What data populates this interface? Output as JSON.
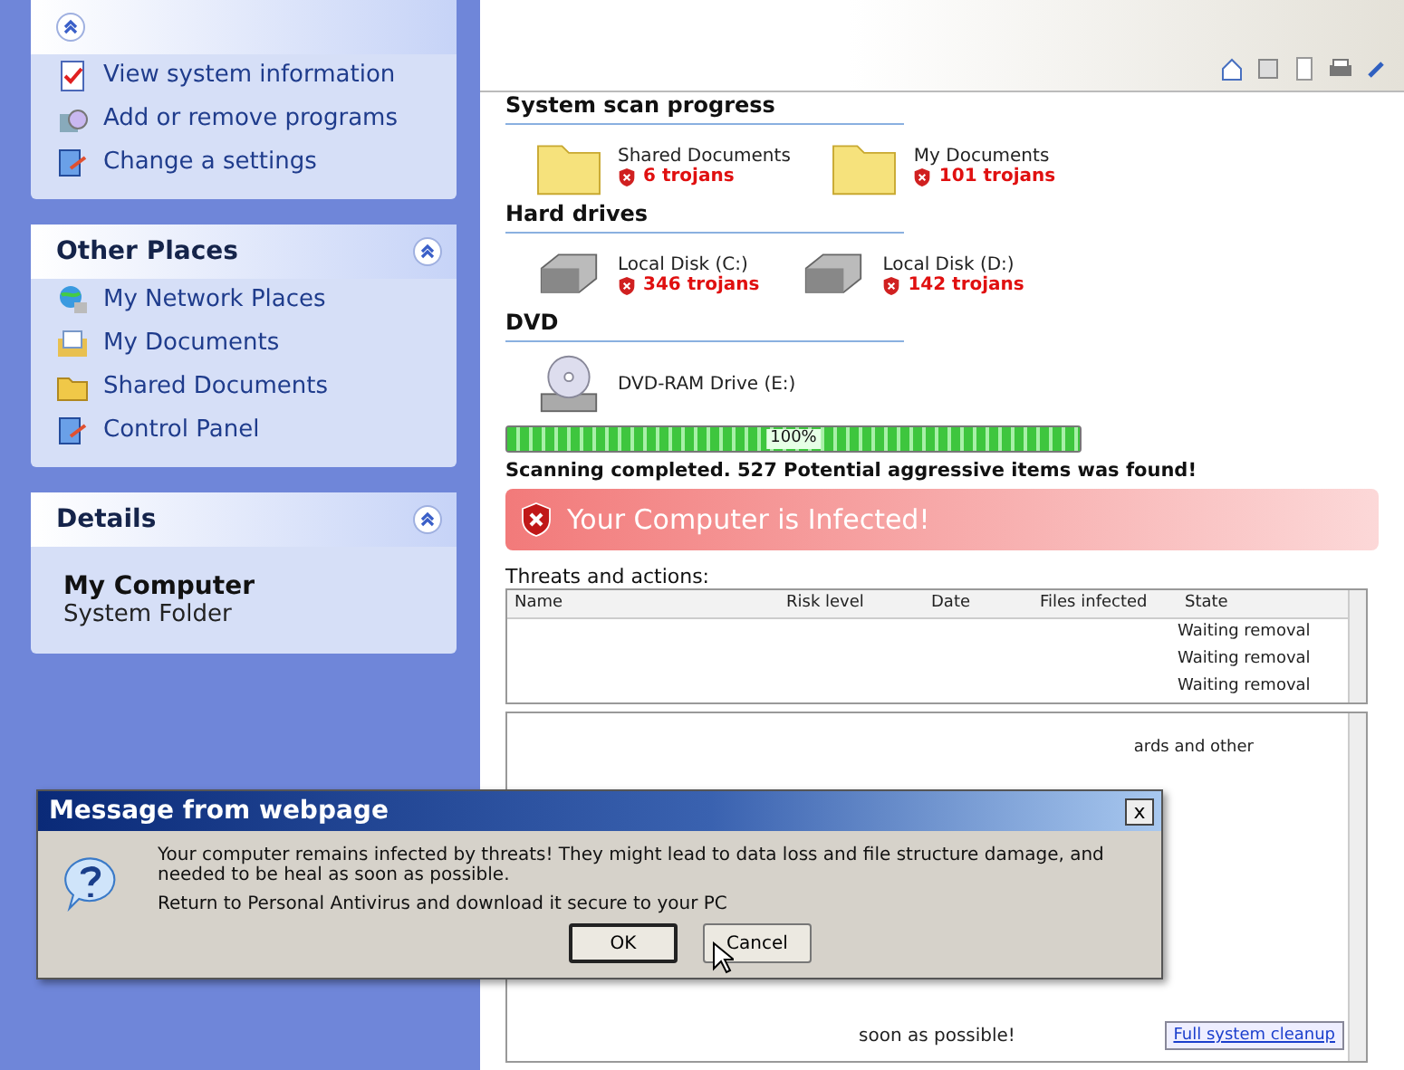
{
  "sidebar": {
    "panels": [
      {
        "items": [
          {
            "label": "View system information",
            "kind": "info"
          },
          {
            "label": "Add or remove programs",
            "kind": "programs"
          },
          {
            "label": "Change a settings",
            "kind": "settings"
          }
        ]
      },
      {
        "title": "Other Places",
        "items": [
          {
            "label": "My Network Places",
            "kind": "network"
          },
          {
            "label": "My Documents",
            "kind": "documents"
          },
          {
            "label": "Shared Documents",
            "kind": "folder"
          },
          {
            "label": "Control Panel",
            "kind": "settings"
          }
        ]
      }
    ],
    "details": {
      "title": "Details",
      "name": "My Computer",
      "subtitle": "System Folder"
    }
  },
  "scan": {
    "sections": [
      {
        "title": "System scan progress",
        "items": [
          {
            "label": "Shared Documents",
            "kind": "folder",
            "threats": "6 trojans"
          },
          {
            "label": "My Documents",
            "kind": "folder",
            "threats": "101 trojans"
          }
        ]
      },
      {
        "title": "Hard drives",
        "items": [
          {
            "label": "Local Disk (C:)",
            "kind": "disk",
            "threats": "346 trojans"
          },
          {
            "label": "Local Disk (D:)",
            "kind": "disk",
            "threats": "142 trojans"
          }
        ]
      },
      {
        "title": "DVD",
        "items": [
          {
            "label": "DVD-RAM Drive (E:)",
            "kind": "dvd"
          }
        ]
      }
    ],
    "progress": {
      "level": 1,
      "label": "100%"
    },
    "message": "Scanning completed. 527 Potential aggressive items was found!",
    "alert": "Your Computer is Infected!"
  },
  "threats": {
    "label": "Threats and actions:",
    "columns": [
      "Name",
      "Risk level",
      "Date",
      "Files infected",
      "State"
    ],
    "rows": [
      {
        "state": "Waiting removal"
      },
      {
        "state": "Waiting removal"
      },
      {
        "state": "Waiting removal"
      }
    ]
  },
  "lower_panel": {
    "text_1": "ards and other",
    "text_2": "soon as possible!",
    "link": "Full system cleanup"
  },
  "dialog": {
    "title": "Message from webpage",
    "close": "x",
    "lines": [
      "Your computer remains infected by threats! They might lead to data loss and file structure damage, and needed to be heal as soon as possible.",
      "Return to Personal Antivirus and download it secure to your PC"
    ],
    "buttons": [
      "OK",
      "Cancel"
    ]
  }
}
